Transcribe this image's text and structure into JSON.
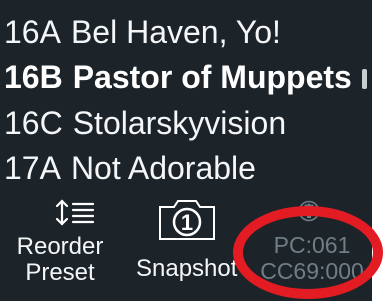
{
  "presets": [
    {
      "number": "16A",
      "name": "Bel Haven, Yo!",
      "selected": false
    },
    {
      "number": "16B",
      "name": "Pastor of Muppets",
      "selected": true
    },
    {
      "number": "16C",
      "name": "Stolarskyvision",
      "selected": false
    },
    {
      "number": "17A",
      "name": "Not Adorable",
      "selected": false
    }
  ],
  "toolbar": {
    "reorder": {
      "line1": "Reorder",
      "line2": "Preset",
      "icon": "reorder-icon"
    },
    "snapshot": {
      "label": "Snapshot",
      "number": "1",
      "icon": "camera-icon"
    },
    "pc_display": {
      "pc": "PC:061",
      "cc": "CC69:000",
      "icon": "midi-icon"
    }
  },
  "colors": {
    "background": "#1c242a",
    "text": "#f4f6f7",
    "dim_text": "#717d85",
    "annotation": "#e31b23"
  }
}
